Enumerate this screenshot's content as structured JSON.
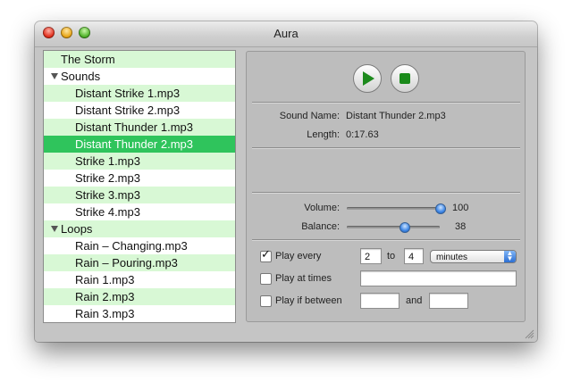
{
  "window": {
    "title": "Aura"
  },
  "sound_list": {
    "rows": [
      {
        "label": "The Storm",
        "level": 0,
        "style": "g"
      },
      {
        "label": "Sounds",
        "level": 0,
        "style": "w",
        "expander": true
      },
      {
        "label": "Distant Strike 1.mp3",
        "level": 1,
        "style": "g"
      },
      {
        "label": "Distant Strike 2.mp3",
        "level": 1,
        "style": "w"
      },
      {
        "label": "Distant Thunder 1.mp3",
        "level": 1,
        "style": "g"
      },
      {
        "label": "Distant Thunder 2.mp3",
        "level": 1,
        "style": "sel"
      },
      {
        "label": "Strike 1.mp3",
        "level": 1,
        "style": "g"
      },
      {
        "label": "Strike 2.mp3",
        "level": 1,
        "style": "w"
      },
      {
        "label": "Strike 3.mp3",
        "level": 1,
        "style": "g"
      },
      {
        "label": "Strike 4.mp3",
        "level": 1,
        "style": "w"
      },
      {
        "label": "Loops",
        "level": 0,
        "style": "g",
        "expander": true
      },
      {
        "label": "Rain – Changing.mp3",
        "level": 1,
        "style": "w"
      },
      {
        "label": "Rain – Pouring.mp3",
        "level": 1,
        "style": "g"
      },
      {
        "label": "Rain 1.mp3",
        "level": 1,
        "style": "w"
      },
      {
        "label": "Rain 2.mp3",
        "level": 1,
        "style": "g"
      },
      {
        "label": "Rain 3.mp3",
        "level": 1,
        "style": "w"
      }
    ]
  },
  "info": {
    "sound_name_label": "Sound Name:",
    "sound_name_value": "Distant Thunder 2.mp3",
    "length_label": "Length:",
    "length_value": "0:17.63"
  },
  "levels": {
    "volume_label": "Volume:",
    "volume_value": "100",
    "balance_label": "Balance:",
    "balance_value": "38"
  },
  "schedule": {
    "play_every_label": "Play every",
    "play_every_checked": true,
    "every_from": "2",
    "to_label": "to",
    "every_to": "4",
    "unit": "minutes",
    "play_at_times_label": "Play at times",
    "play_at_times_checked": false,
    "play_at_times_value": "",
    "play_if_between_label": "Play if between",
    "play_if_between_checked": false,
    "and_label": "and",
    "between_from": "",
    "between_to": ""
  },
  "colors": {
    "row_green": "#d8f8d5",
    "row_selected": "#2fc45c",
    "play_green": "#1d8a1d"
  }
}
